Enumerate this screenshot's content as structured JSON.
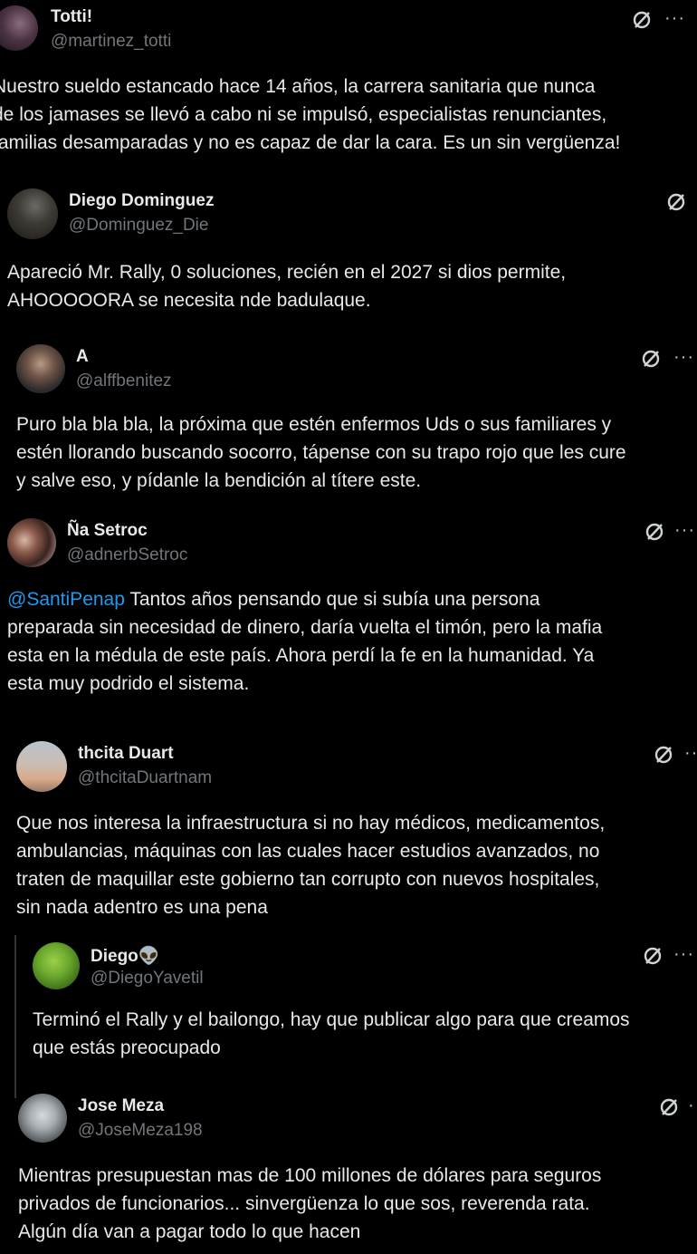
{
  "tweets": [
    {
      "name": "Totti!",
      "handle": "@martinez_totti",
      "lines": [
        "Nuestro sueldo estancado hace 14 años, la carrera sanitaria que nunca",
        "de los jamases se llevó a cabo ni se impulsó, especialistas renunciantes,",
        "familias desamparadas y no es capaz de dar la cara. Es un sin vergüenza!"
      ]
    },
    {
      "name": "Diego Dominguez",
      "handle": "@Dominguez_Die",
      "lines": [
        "Apareció Mr. Rally, 0 soluciones, recién en el 2027 si dios permite,",
        "AHOOOOORA se necesita nde badulaque."
      ]
    },
    {
      "name": "A",
      "handle": "@alffbenitez",
      "lines": [
        "Puro bla bla bla, la próxima que estén enfermos Uds o sus familiares y",
        "estén llorando buscando socorro, tápense con su trapo rojo que les cure",
        "y salve eso, y pídanle la bendición al títere este."
      ]
    },
    {
      "name": "Ña Setroc",
      "handle": "@adnerbSetroc",
      "mention": "@SantiPenap",
      "lines": [
        " Tantos años pensando que si subía una persona",
        "preparada sin necesidad de dinero, daría vuelta el timón, pero la mafia",
        "esta en la médula de este país. Ahora perdí la fe en la humanidad. Ya",
        "esta muy podrido el sistema."
      ]
    },
    {
      "name": "thcita Duart",
      "handle": "@thcitaDuartnam",
      "lines": [
        "Que nos interesa la infraestructura si no hay médicos, medicamentos,",
        "ambulancias, máquinas con las cuales hacer estudios avanzados, no",
        "traten de maquillar este gobierno tan corrupto con nuevos hospitales,",
        "sin nada adentro es una pena"
      ]
    },
    {
      "name": "Diego👽",
      "handle": "@DiegoYavetil",
      "lines": [
        "Terminó el Rally y el bailongo, hay que publicar algo para que creamos",
        "que estás preocupado"
      ]
    },
    {
      "name": "Jose Meza",
      "handle": "@JoseMeza198",
      "lines": [
        "Mientras presupuestan mas de 100 millones de dólares para seguros",
        "privados de funcionarios... sinvergüenza lo que sos, reverenda rata.",
        "Algún día van a pagar todo lo que hacen"
      ]
    }
  ],
  "icons": {
    "grok": "grok-icon",
    "more": "more-icon",
    "more_glyph": "···"
  },
  "colors": {
    "background": "#000000",
    "text": "#e7e9ea",
    "secondary": "#71767b",
    "mention": "#1d9bf0"
  }
}
